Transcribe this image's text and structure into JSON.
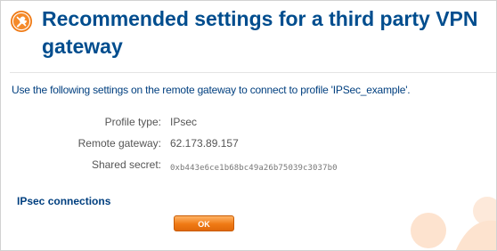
{
  "page": {
    "title": "Recommended settings for a third party VPN gateway",
    "intro": "Use the following settings on the remote gateway to connect to profile 'IPSec_example'."
  },
  "settings": [
    {
      "label": "Profile type:",
      "value": "IPsec"
    },
    {
      "label": "Remote gateway:",
      "value": "62.173.89.157"
    },
    {
      "label": "Shared secret:",
      "value": "0xb443e6ce1b68bc49a26b75039c3037b0"
    }
  ],
  "section": {
    "heading": "IPsec connections"
  },
  "buttons": {
    "ok_label": "OK"
  },
  "colors": {
    "title": "#004d8e",
    "accent": "#f07a14",
    "watermark": "#fde3cf"
  },
  "icons": {
    "title_icon": "wrench-icon"
  }
}
